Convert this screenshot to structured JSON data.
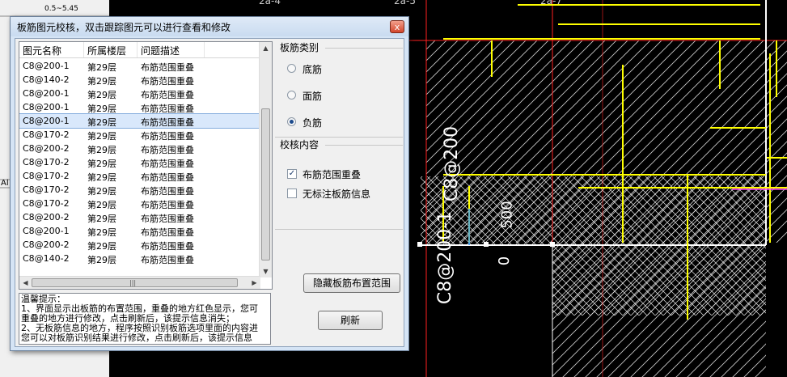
{
  "background_cad": {
    "ruler_value": "0.5~5.45",
    "axis_labels": [
      "2a-4",
      "2a-5",
      "2a-7"
    ],
    "left_strip_text": "Al",
    "rebar_labels": {
      "vertical_label_1": "C8@200",
      "vertical_label_2": "C8@200-1",
      "dim_500": "500",
      "dim_0": "0"
    }
  },
  "dialog": {
    "title": "板筋图元校核，双击跟踪图元可以进行查看和修改",
    "close_label": "x",
    "list": {
      "columns": [
        "图元名称",
        "所属楼层",
        "问题描述"
      ],
      "rows": [
        [
          "C8@200-1",
          "第29层",
          "布筋范围重叠"
        ],
        [
          "C8@140-2",
          "第29层",
          "布筋范围重叠"
        ],
        [
          "C8@200-1",
          "第29层",
          "布筋范围重叠"
        ],
        [
          "C8@200-1",
          "第29层",
          "布筋范围重叠"
        ],
        [
          "C8@200-1",
          "第29层",
          "布筋范围重叠"
        ],
        [
          "C8@170-2",
          "第29层",
          "布筋范围重叠"
        ],
        [
          "C8@200-2",
          "第29层",
          "布筋范围重叠"
        ],
        [
          "C8@170-2",
          "第29层",
          "布筋范围重叠"
        ],
        [
          "C8@170-2",
          "第29层",
          "布筋范围重叠"
        ],
        [
          "C8@170-2",
          "第29层",
          "布筋范围重叠"
        ],
        [
          "C8@170-2",
          "第29层",
          "布筋范围重叠"
        ],
        [
          "C8@200-2",
          "第29层",
          "布筋范围重叠"
        ],
        [
          "C8@200-1",
          "第29层",
          "布筋范围重叠"
        ],
        [
          "C8@200-2",
          "第29层",
          "布筋范围重叠"
        ],
        [
          "C8@140-2",
          "第29层",
          "布筋范围重叠"
        ]
      ],
      "selected_index": 4
    },
    "rebar_type": {
      "label": "板筋类别",
      "options": [
        "底筋",
        "面筋",
        "负筋"
      ],
      "selected": "负筋"
    },
    "check_content": {
      "label": "校核内容",
      "items": [
        {
          "label": "布筋范围重叠",
          "checked": true
        },
        {
          "label": "无标注板筋信息",
          "checked": false
        }
      ]
    },
    "hide_button": "隐藏板筋布置范围",
    "refresh_button": "刷新",
    "tips": [
      "温馨提示：",
      "1、界面显示出板筋的布置范围，重叠的地方红色显示，您可",
      "重叠的地方进行修改，点击刷新后，该提示信息消失；",
      "2、无板筋信息的地方，程序按照识别板筋选项里面的内容进",
      "您可以对板筋识别结果进行修改，点击刷新后，该提示信息"
    ]
  },
  "colors": {
    "cad_background": "#000000",
    "cad_yellow": "#ffff00",
    "cad_red": "#ff2020",
    "dialog_frame": "#d5e4f5",
    "selected_row": "#d9e8fb"
  }
}
